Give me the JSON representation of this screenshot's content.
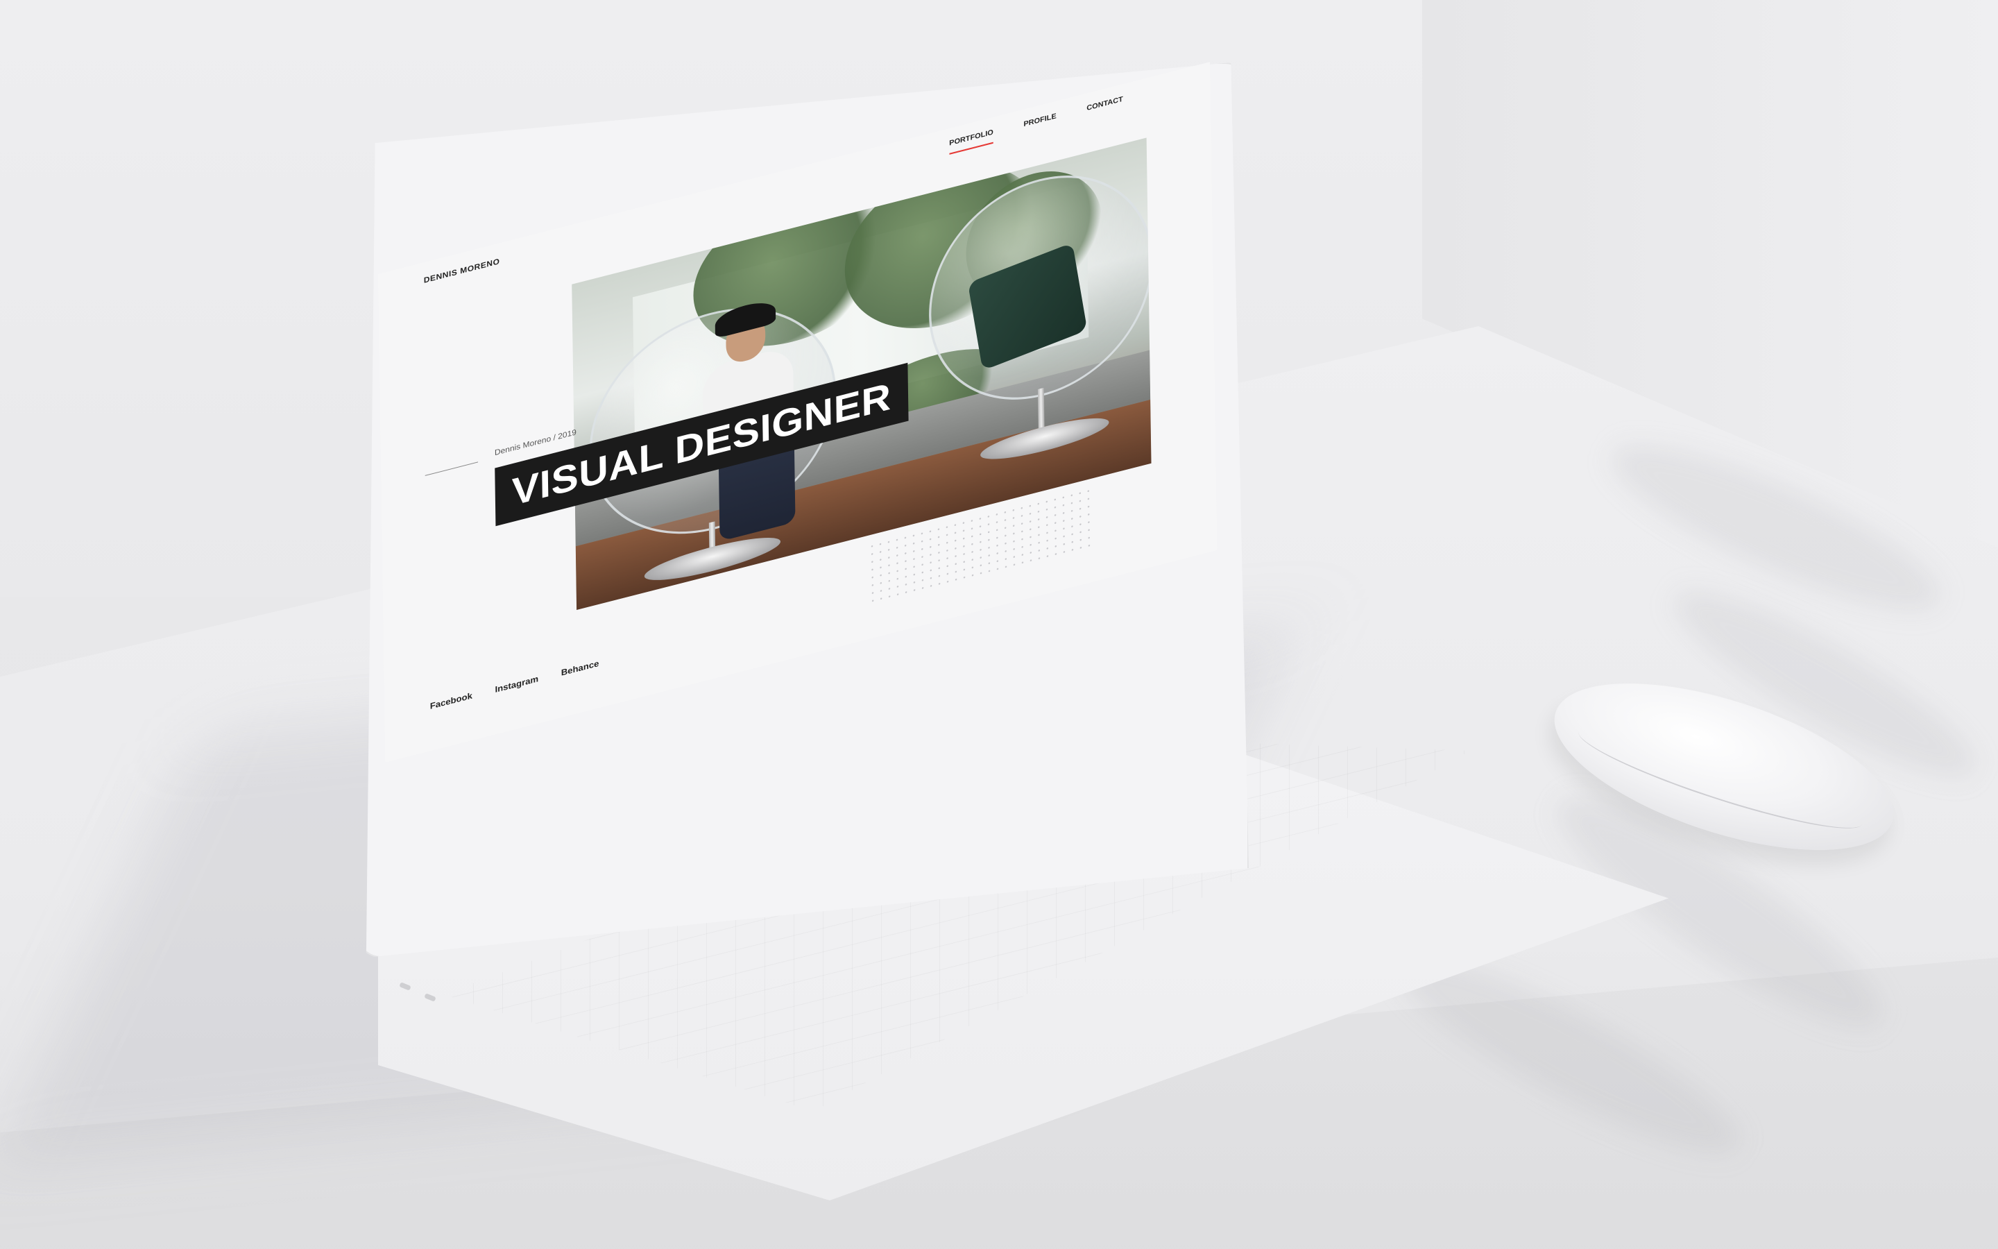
{
  "site": {
    "brand": "DENNIS MORENO",
    "nav": [
      {
        "label": "PORTFOLIO",
        "active": true
      },
      {
        "label": "PROFILE",
        "active": false
      },
      {
        "label": "CONTACT",
        "active": false
      }
    ],
    "meta": "Dennis Moreno / 2019",
    "headline": "VISUAL DESIGNER",
    "socials": [
      "Facebook",
      "Instagram",
      "Behance"
    ]
  },
  "colors": {
    "accent": "#e53935",
    "title_bar": "#1b1b1b",
    "text": "#222222"
  },
  "icons": {
    "hero": "portrait-photo",
    "pattern": "dot-grid-decoration"
  }
}
